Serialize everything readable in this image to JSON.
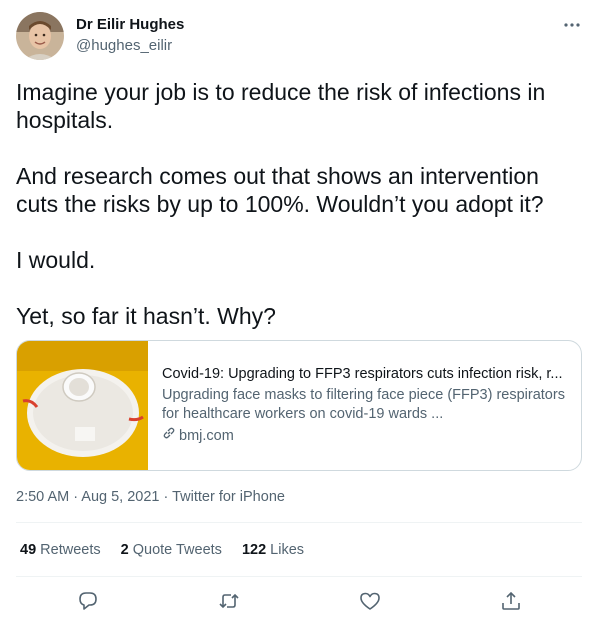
{
  "author": {
    "name": "Dr Eilir Hughes",
    "handle": "@hughes_eilir"
  },
  "tweet": {
    "paragraphs": [
      "Imagine your job is to reduce the risk of infections in hospitals.",
      "And research comes out that shows an intervention cuts the risks by up to 100%. Wouldn’t you adopt it?",
      "I would.",
      "Yet, so far it hasn’t. Why?"
    ]
  },
  "card": {
    "title": "Covid-19: Upgrading to FFP3 respirators cuts infection risk, r...",
    "description": "Upgrading face masks to filtering face piece (FFP3) respirators for healthcare workers on covid-19 wards ...",
    "domain": "bmj.com"
  },
  "meta": {
    "timestamp": "2:50 AM · Aug 5, 2021 · Twitter for iPhone"
  },
  "stats": {
    "retweets_count": "49",
    "retweets_label": "Retweets",
    "quotes_count": "2",
    "quotes_label": "Quote Tweets",
    "likes_count": "122",
    "likes_label": "Likes"
  },
  "actions": [
    {
      "name": "reply",
      "icon": "reply-icon"
    },
    {
      "name": "retweet",
      "icon": "retweet-icon"
    },
    {
      "name": "like",
      "icon": "heart-icon"
    },
    {
      "name": "share",
      "icon": "share-icon"
    }
  ],
  "colors": {
    "text": "#0f1419",
    "secondary": "#536471",
    "border": "#cfd9de"
  }
}
